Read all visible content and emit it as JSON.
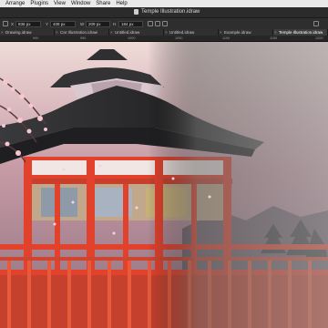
{
  "menubar": {
    "items": [
      "Arrange",
      "Plugins",
      "View",
      "Window",
      "Share",
      "Help"
    ]
  },
  "window": {
    "title": "Temple Illustration.idraw"
  },
  "toolbar": {
    "x_value": "836 px",
    "y_value": "408 px",
    "w_value": "209 px",
    "h_value": "184 px",
    "x_label": "X",
    "y_label": "Y",
    "w_label": "W",
    "h_label": "H",
    "angle_label": "∠"
  },
  "tabs": [
    {
      "label": "Drawing.idraw",
      "active": false
    },
    {
      "label": "Car Illustration.idraw",
      "active": false
    },
    {
      "label": "Untitled.idraw",
      "active": false
    },
    {
      "label": "Untitled.idraw",
      "active": false
    },
    {
      "label": "Example.idraw",
      "active": false
    },
    {
      "label": "Temple Illustration.idraw",
      "active": true
    }
  ],
  "ruler": {
    "ticks": [
      "900",
      "950",
      "1000",
      "1050",
      "1100",
      "1150",
      "1200"
    ]
  },
  "colors": {
    "sky_top": "#f0dbd8",
    "sky_mid": "#c59aa5",
    "sky_low": "#8d6e7c",
    "roof": "#2b2b2d",
    "pillar_red": "#e2412c",
    "blossom": "#f4c7d0"
  }
}
